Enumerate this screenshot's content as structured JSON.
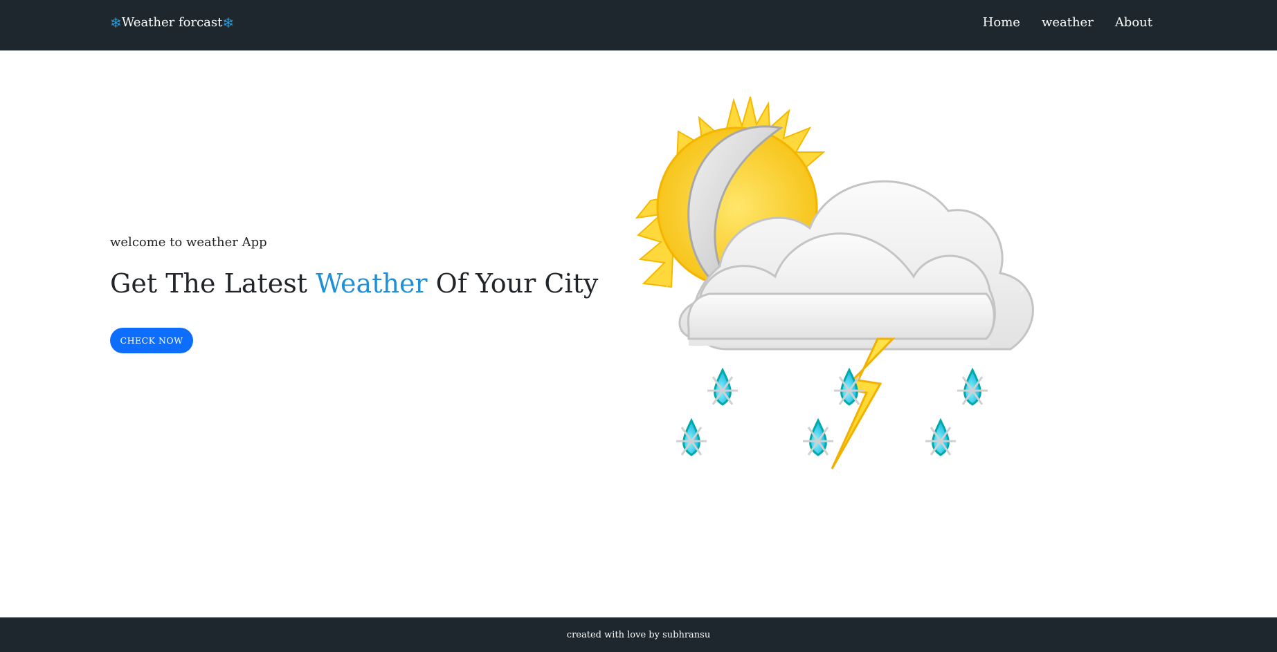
{
  "navbar": {
    "brand_prefix_icon": "❄",
    "brand_text": "Weather forcast",
    "brand_suffix_icon": "❄",
    "links": [
      {
        "label": "Home"
      },
      {
        "label": "weather"
      },
      {
        "label": "About"
      }
    ]
  },
  "hero": {
    "welcome": "welcome to weather App",
    "headline_before": "Get The Latest ",
    "headline_accent": "Weather",
    "headline_after": " Of Your City",
    "cta_label": "CHECK NOW",
    "illustration": "sun-moon-cloud-thunder-snow-illustration",
    "carousel_prev": "‹",
    "carousel_next": "›"
  },
  "footer": {
    "text": "created with love by subhransu"
  },
  "colors": {
    "navbar_bg": "#1e272e",
    "accent_blue": "#1e90d8",
    "button_blue": "#0d6efd"
  }
}
